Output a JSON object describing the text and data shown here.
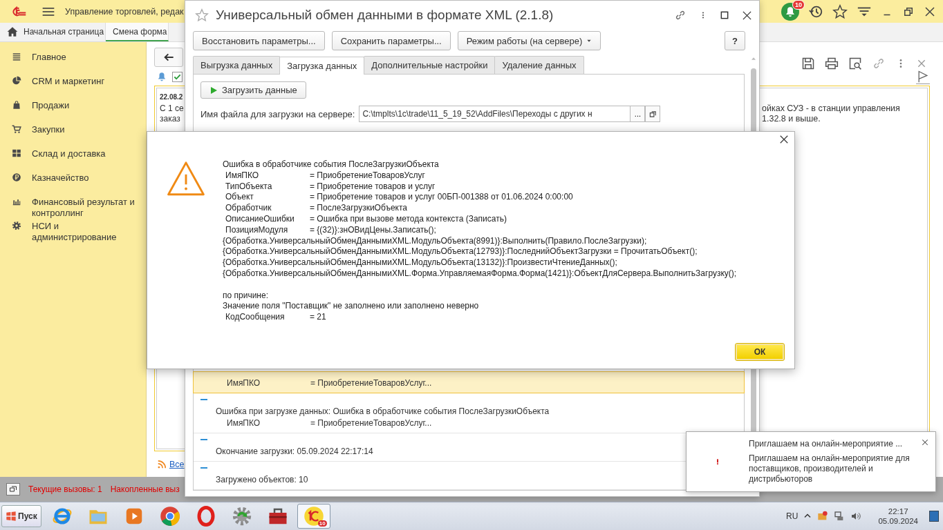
{
  "app": {
    "title": "Управление торговлей, редак",
    "notifications_badge": "10"
  },
  "tabs": [
    {
      "label": "Начальная страница",
      "selected": false
    },
    {
      "label": "Смена форма",
      "selected": true
    }
  ],
  "sidebar": {
    "items": [
      {
        "label": "Главное"
      },
      {
        "label": "CRM и маркетинг"
      },
      {
        "label": "Продажи"
      },
      {
        "label": "Закупки"
      },
      {
        "label": "Склад и доставка"
      },
      {
        "label": "Казначейство"
      },
      {
        "label": "Финансовый результат и контроллинг"
      },
      {
        "label": "НСИ и администрирование"
      }
    ]
  },
  "news": {
    "checkbox_checked": true,
    "date": "22.08.2",
    "left_lines": [
      "С 1 се",
      "заказ"
    ],
    "right_lines": [
      "ойках СУЗ - в станции управления",
      "1.32.8 и выше."
    ],
    "all_link": "Все"
  },
  "status_bar": {
    "current_calls": "Текущие вызовы: 1",
    "accumulated_calls": "Накопленные выз"
  },
  "exchange_window": {
    "title": "Универсальный обмен данными в формате XML (2.1.8)",
    "buttons": [
      "Восстановить параметры...",
      "Сохранить параметры..."
    ],
    "mode_button": "Режим работы (на сервере)",
    "help_button": "?",
    "tabs": [
      {
        "label": "Выгрузка данных",
        "selected": false
      },
      {
        "label": "Загрузка данных",
        "selected": true
      },
      {
        "label": "Дополнительные настройки",
        "selected": false
      },
      {
        "label": "Удаление данных",
        "selected": false
      }
    ],
    "load_button": "Загрузить данные",
    "file_label": "Имя файла для загрузки на сервере:",
    "file_value": "C:\\tmplts\\1c\\trade\\11_5_19_52\\AddFiles\\Переходы с других н",
    "browse_button": "...",
    "log": [
      {
        "selected": true,
        "lines": [
          {
            "kind": "pair",
            "key": "ИмяПКО",
            "value": "= ПриобретениеТоваровУслуг..."
          }
        ]
      },
      {
        "selected": false,
        "lines": [
          {
            "kind": "text",
            "text": "Ошибка при загрузке данных: Ошибка в обработчике события ПослеЗагрузкиОбъекта"
          },
          {
            "kind": "pair",
            "key": "ИмяПКО",
            "value": "= ПриобретениеТоваровУслуг..."
          }
        ]
      },
      {
        "selected": false,
        "lines": [
          {
            "kind": "text",
            "text": "Окончание загрузки: 05.09.2024 22:17:14"
          }
        ]
      },
      {
        "selected": false,
        "lines": [
          {
            "kind": "text",
            "text": "Загружено объектов: 10"
          }
        ]
      }
    ]
  },
  "error_dialog": {
    "message": [
      {
        "kind": "text",
        "text": "Ошибка в обработчике события ПослеЗагрузкиОбъекта"
      },
      {
        "kind": "pair",
        "key": "ИмяПКО",
        "value": "=  ПриобретениеТоваровУслуг"
      },
      {
        "kind": "pair",
        "key": "ТипОбъекта",
        "value": "=  Приобретение товаров и услуг"
      },
      {
        "kind": "pair",
        "key": "Объект",
        "value": "=  Приобретение товаров и услуг 00БП-001388 от 01.06.2024 0:00:00"
      },
      {
        "kind": "pair",
        "key": "Обработчик",
        "value": "=  ПослеЗагрузкиОбъекта"
      },
      {
        "kind": "pair",
        "key": "ОписаниеОшибки",
        "value": "=  Ошибка при вызове метода контекста (Записать)"
      },
      {
        "kind": "pair",
        "key": "ПозицияМодуля",
        "value": "=  {(32)}:знОВидЦены.Записать();"
      },
      {
        "kind": "text",
        "text": "{Обработка.УниверсальныйОбменДаннымиXML.МодульОбъекта(8991)}:Выполнить(Правило.ПослеЗагрузки);"
      },
      {
        "kind": "text",
        "text": "{Обработка.УниверсальныйОбменДаннымиXML.МодульОбъекта(12793)}:ПоследнийОбъектЗагрузки = ПрочитатьОбъект();"
      },
      {
        "kind": "text",
        "text": "{Обработка.УниверсальныйОбменДаннымиXML.МодульОбъекта(13132)}:ПроизвестиЧтениеДанных();"
      },
      {
        "kind": "text",
        "text": "{Обработка.УниверсальныйОбменДаннымиXML.Форма.УправляемаяФорма.Форма(1421)}:ОбъектДляСервера.ВыполнитьЗагрузку();"
      }
    ],
    "reason": [
      {
        "kind": "text",
        "text": "по причине:"
      },
      {
        "kind": "text",
        "text": "Значение поля \"Поставщик\" не заполнено или заполнено неверно"
      },
      {
        "kind": "pair",
        "key": "КодСообщения",
        "value": "=  21"
      }
    ],
    "ok_button": "ОК"
  },
  "notification": {
    "title": "Приглашаем на онлайн-мероприятие ...",
    "body": "Приглашаем на онлайн-мероприятие для поставщиков, производителей и дистрибьюторов"
  },
  "taskbar": {
    "start": "Пуск",
    "apps": [
      {
        "selected": false
      },
      {
        "selected": false
      },
      {
        "selected": false
      },
      {
        "selected": false
      },
      {
        "selected": false
      },
      {
        "selected": false
      },
      {
        "selected": false
      },
      {
        "selected": true
      }
    ],
    "app_badge": "10",
    "language": "RU",
    "time": "22:17",
    "date": "05.09.2024"
  }
}
